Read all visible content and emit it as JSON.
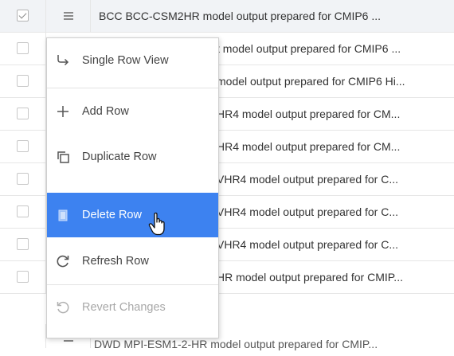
{
  "grid": {
    "rows": [
      {
        "checked": true,
        "desc": "BCC BCC-CSM2HR model output prepared for CMIP6 ..."
      },
      {
        "checked": false,
        "desc": "t model output prepared for CMIP6 ..."
      },
      {
        "checked": false,
        "desc": "model output prepared for CMIP6 Hi..."
      },
      {
        "checked": false,
        "desc": "HR4 model output prepared for CM..."
      },
      {
        "checked": false,
        "desc": "HR4 model output prepared for CM..."
      },
      {
        "checked": false,
        "desc": "VHR4 model output prepared for C..."
      },
      {
        "checked": false,
        "desc": "VHR4 model output prepared for C..."
      },
      {
        "checked": false,
        "desc": "VHR4 model output prepared for C..."
      },
      {
        "checked": false,
        "desc": "HR model output prepared for CMIP..."
      },
      {
        "checked": false,
        "desc": "DWD MPI-ESM1-2-HR model output prepared for CMIP..."
      }
    ]
  },
  "context_menu": {
    "items": [
      {
        "label": "Single Row View",
        "icon": "return-arrow-icon"
      },
      {
        "label": "Add Row",
        "icon": "plus-icon"
      },
      {
        "label": "Duplicate Row",
        "icon": "duplicate-icon"
      },
      {
        "label": "Delete Row",
        "icon": "trash-icon",
        "state": "hover"
      },
      {
        "label": "Refresh Row",
        "icon": "refresh-icon"
      },
      {
        "label": "Revert Changes",
        "icon": "revert-icon",
        "state": "disabled"
      }
    ]
  },
  "colors": {
    "accent": "#3d82f0",
    "border": "#e6e6e6",
    "text": "#333333",
    "disabled": "#a8a8a8"
  }
}
